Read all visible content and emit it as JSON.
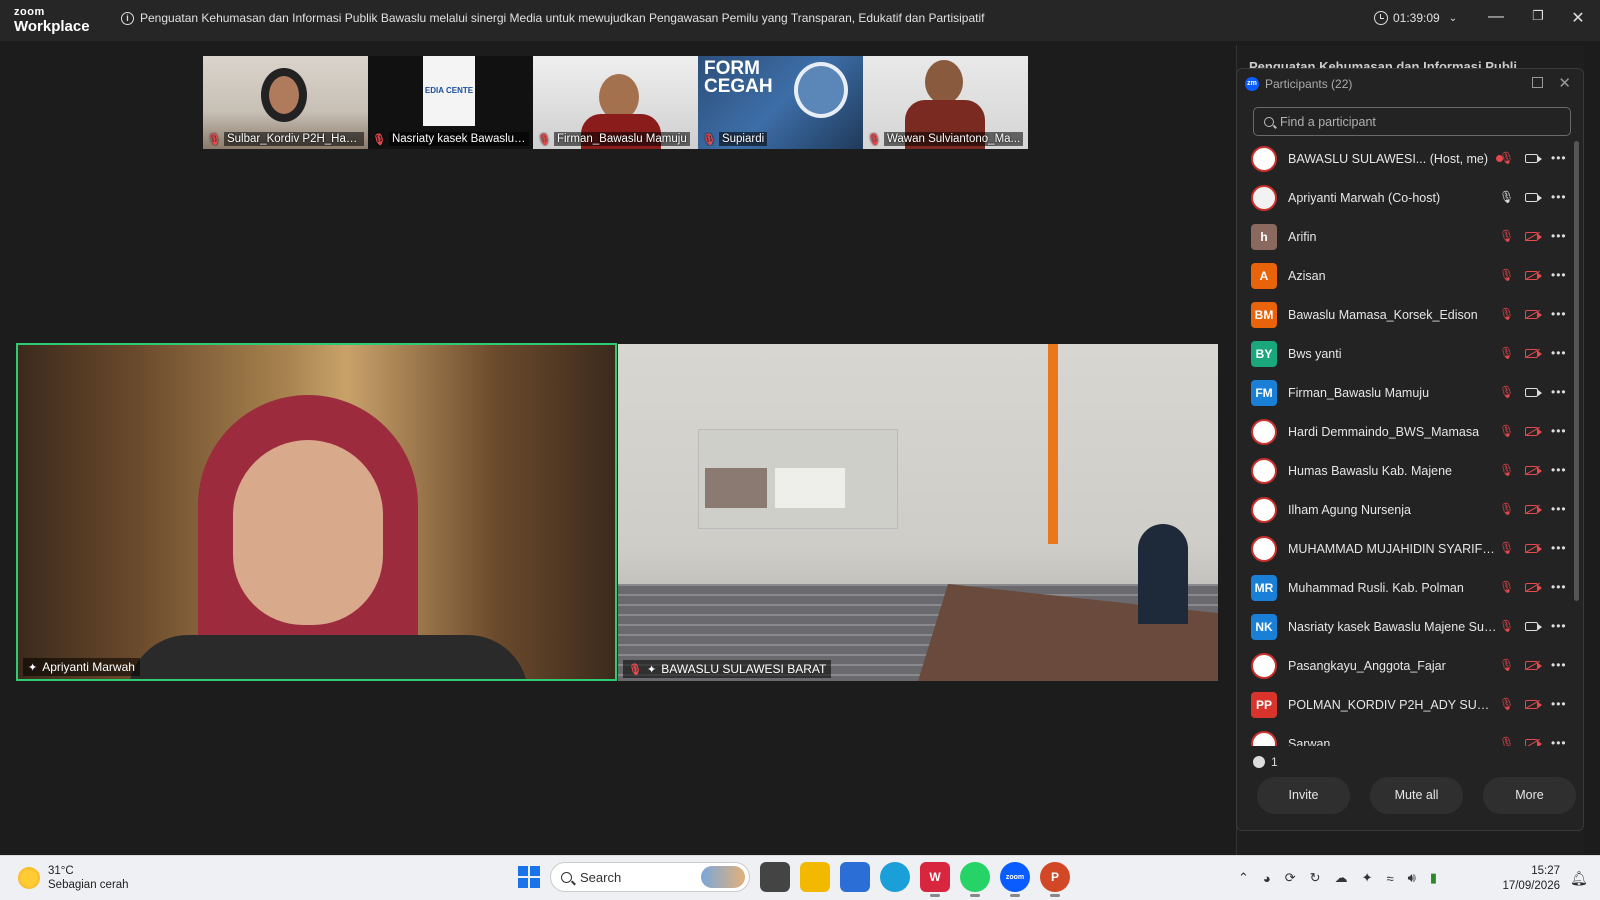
{
  "app": {
    "brand_top": "zoom",
    "brand_bottom": "Workplace",
    "meeting_topic": "Penguatan Kehumasan dan Informasi Publik Bawaslu melalui sinergi Media untuk mewujudkan Pengawasan Pemilu yang Transparan, Edukatif dan Partisipatif",
    "timer": "01:39:09",
    "accent_color": "#2ecc71"
  },
  "thumbnails": [
    {
      "name": "Sulbar_Kordiv P2H_Hamr..."
    },
    {
      "name": "Nasriaty kasek Bawaslu ..."
    },
    {
      "name": "Firman_Bawaslu Mamuju"
    },
    {
      "name": "Supiardi"
    },
    {
      "name": "Wawan Sulviantono_Ma..."
    }
  ],
  "thumb_overlay_text": {
    "form_cegah": "FORM CEGAH",
    "media_centre": "EDIA CENTE"
  },
  "main_videos": {
    "left_label": "Apriyanti Marwah",
    "right_label": "BAWASLU SULAWESI BARAT"
  },
  "panel": {
    "behind_title": "Penguatan Kehumasan dan Informasi Publi...",
    "title": "Participants (22)",
    "search_placeholder": "Find a participant",
    "waiting_count": "1",
    "buttons": {
      "invite": "Invite",
      "mute_all": "Mute all",
      "more": "More"
    }
  },
  "participants": [
    {
      "name": "BAWASLU SULAWESI... (Host, me)",
      "avatar": "",
      "avatar_color": "#ffffff",
      "mic": "off",
      "cam": "on",
      "rec": true
    },
    {
      "name": "Apriyanti Marwah (Co-host)",
      "avatar": "",
      "avatar_color": "#f2f2f2",
      "mic": "on",
      "cam": "on"
    },
    {
      "name": "Arifin",
      "avatar": "h",
      "avatar_color": "#8a6a5e",
      "mic": "off",
      "cam": "off"
    },
    {
      "name": "Azisan",
      "avatar": "A",
      "avatar_color": "#e8630a",
      "mic": "off",
      "cam": "off"
    },
    {
      "name": "Bawaslu Mamasa_Korsek_Edison",
      "avatar": "BM",
      "avatar_color": "#e8630a",
      "mic": "off",
      "cam": "off"
    },
    {
      "name": "Bws yanti",
      "avatar": "BY",
      "avatar_color": "#1aa77c",
      "mic": "off",
      "cam": "off"
    },
    {
      "name": "Firman_Bawaslu Mamuju",
      "avatar": "FM",
      "avatar_color": "#1a7fd6",
      "mic": "off",
      "cam": "on"
    },
    {
      "name": "Hardi Demmaindo_BWS_Mamasa",
      "avatar": "",
      "avatar_color": "#ffffff",
      "mic": "off",
      "cam": "off"
    },
    {
      "name": "Humas Bawaslu Kab. Majene",
      "avatar": "",
      "avatar_color": "#ffffff",
      "mic": "off",
      "cam": "off"
    },
    {
      "name": "Ilham Agung Nursenja",
      "avatar": "",
      "avatar_color": "#ffffff",
      "mic": "off",
      "cam": "off"
    },
    {
      "name": "MUHAMMAD MUJAHIDIN SYARIFU...",
      "avatar": "",
      "avatar_color": "#ffffff",
      "mic": "off",
      "cam": "off"
    },
    {
      "name": "Muhammad Rusli. Kab. Polman",
      "avatar": "MR",
      "avatar_color": "#1a7fd6",
      "mic": "off",
      "cam": "off"
    },
    {
      "name": "Nasriaty kasek Bawaslu Majene SulBar",
      "avatar": "NK",
      "avatar_color": "#1a7fd6",
      "mic": "off",
      "cam": "on"
    },
    {
      "name": "Pasangkayu_Anggota_Fajar",
      "avatar": "",
      "avatar_color": "#ffffff",
      "mic": "off",
      "cam": "off"
    },
    {
      "name": "POLMAN_KORDIV P2H_ADY SURAT...",
      "avatar": "PP",
      "avatar_color": "#d9342b",
      "mic": "off",
      "cam": "off"
    },
    {
      "name": "Sarwan",
      "avatar": "",
      "avatar_color": "#ffffff",
      "mic": "off",
      "cam": "off"
    }
  ],
  "taskbar": {
    "temperature": "31°C",
    "weather": "Sebagian cerah",
    "search_label": "Search",
    "time": "15:27",
    "date": "17/09/2026"
  }
}
